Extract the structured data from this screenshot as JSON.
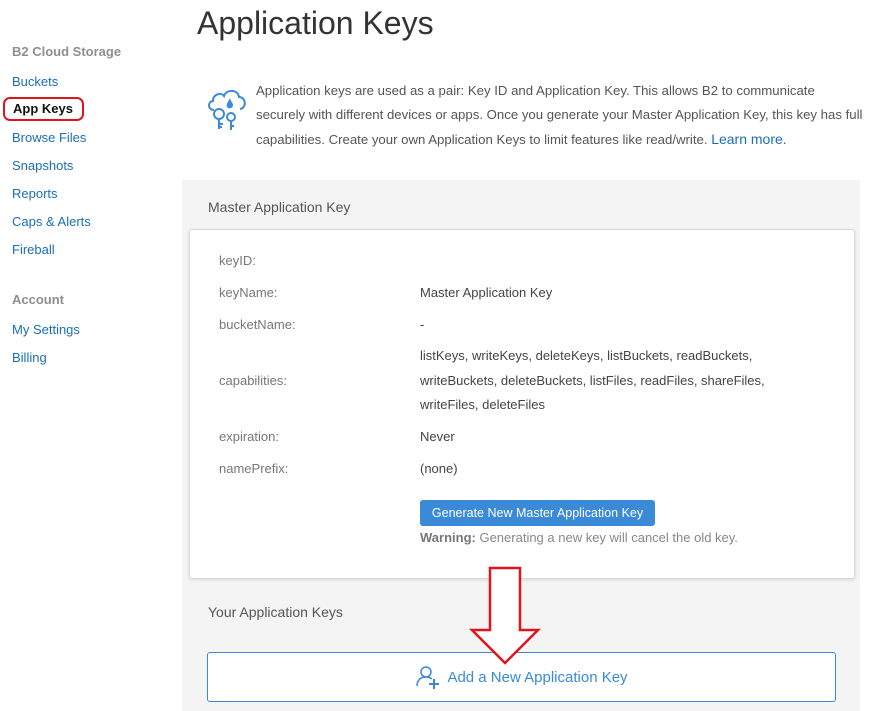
{
  "sidebar": {
    "heading": "B2 Cloud Storage",
    "items": [
      "Buckets",
      "App Keys",
      "Browse Files",
      "Snapshots",
      "Reports",
      "Caps & Alerts",
      "Fireball"
    ],
    "active": "App Keys",
    "account_heading": "Account",
    "account_items": [
      "My Settings",
      "Billing"
    ]
  },
  "page": {
    "title": "Application Keys",
    "intro": "Application keys are used as a pair: Key ID and Application Key. This allows B2 to communicate securely with different devices or apps. Once you generate your Master Application Key, this key has full capabilities. Create your own Application Keys to limit features like read/write.",
    "learn_more": "Learn more."
  },
  "master": {
    "section_title": "Master Application Key",
    "labels": {
      "keyID": "keyID:",
      "keyName": "keyName:",
      "bucketName": "bucketName:",
      "capabilities": "capabilities:",
      "expiration": "expiration:",
      "namePrefix": "namePrefix:"
    },
    "values": {
      "keyName": "Master Application Key",
      "bucketName": "-",
      "capabilities": "listKeys, writeKeys, deleteKeys, listBuckets, readBuckets, writeBuckets, deleteBuckets, listFiles, readFiles, shareFiles, writeFiles, deleteFiles",
      "expiration": "Never",
      "namePrefix": "(none)"
    },
    "generate_button": "Generate New Master Application Key",
    "warning_label": "Warning:",
    "warning_text": "Generating a new key will cancel the old key."
  },
  "your_keys": {
    "section_title": "Your Application Keys",
    "add_button": "Add a New Application Key"
  },
  "colors": {
    "accent": "#3a8ad8",
    "link": "#1a6fb5",
    "highlight": "#e0141e",
    "panel": "#f4f4f4"
  },
  "icons": {
    "intro": "cloud-key-icon",
    "add": "add-user-icon",
    "annotation": "down-arrow-annotation"
  }
}
